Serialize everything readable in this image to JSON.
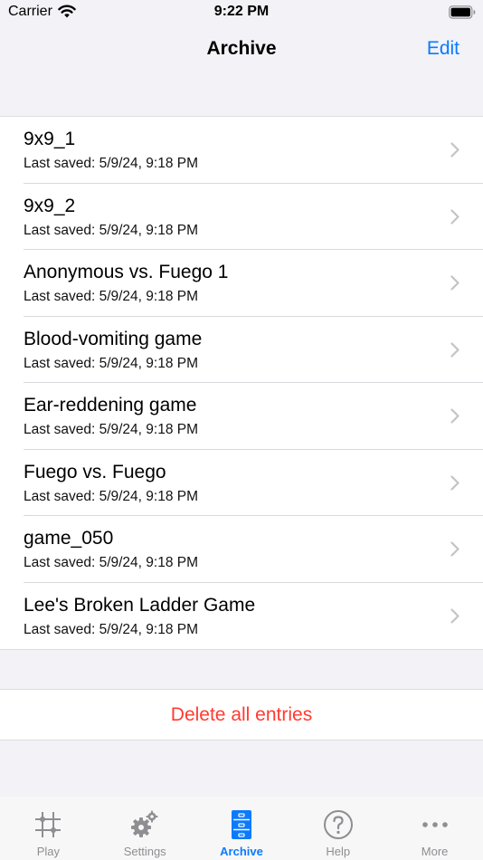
{
  "status_bar": {
    "carrier": "Carrier",
    "time": "9:22 PM"
  },
  "nav": {
    "title": "Archive",
    "edit_label": "Edit"
  },
  "entries": [
    {
      "title": "9x9_1",
      "subtitle": "Last saved: 5/9/24, 9:18 PM"
    },
    {
      "title": "9x9_2",
      "subtitle": "Last saved: 5/9/24, 9:18 PM"
    },
    {
      "title": "Anonymous vs. Fuego 1",
      "subtitle": "Last saved: 5/9/24, 9:18 PM"
    },
    {
      "title": "Blood-vomiting game",
      "subtitle": "Last saved: 5/9/24, 9:18 PM"
    },
    {
      "title": "Ear-reddening game",
      "subtitle": "Last saved: 5/9/24, 9:18 PM"
    },
    {
      "title": "Fuego vs. Fuego",
      "subtitle": "Last saved: 5/9/24, 9:18 PM"
    },
    {
      "title": "game_050",
      "subtitle": "Last saved: 5/9/24, 9:18 PM"
    },
    {
      "title": "Lee's Broken Ladder Game",
      "subtitle": "Last saved: 5/9/24, 9:18 PM"
    }
  ],
  "delete_all_label": "Delete all entries",
  "tabs": [
    {
      "label": "Play",
      "icon": "board-grid-icon",
      "active": false
    },
    {
      "label": "Settings",
      "icon": "gears-icon",
      "active": false
    },
    {
      "label": "Archive",
      "icon": "filing-cabinet-icon",
      "active": true
    },
    {
      "label": "Help",
      "icon": "question-circle-icon",
      "active": false
    },
    {
      "label": "More",
      "icon": "ellipsis-icon",
      "active": false
    }
  ],
  "colors": {
    "accent": "#0a7aff",
    "destructive": "#ff3b30",
    "inactive_tab": "#8e8e93",
    "background": "#f2f2f7"
  }
}
